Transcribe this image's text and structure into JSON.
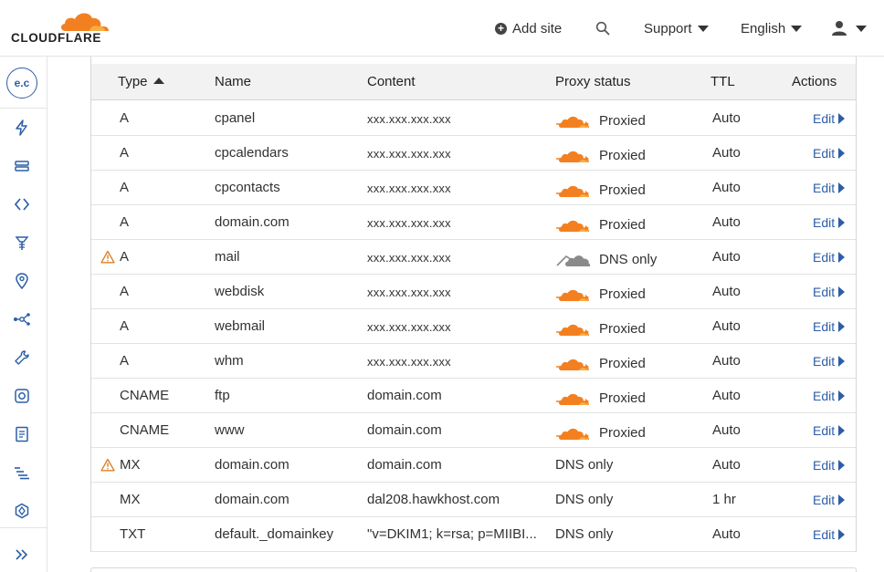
{
  "header": {
    "logo_text": "CLOUDFLARE",
    "add_site_label": "Add site",
    "support_label": "Support",
    "language_label": "English"
  },
  "sidebar": {
    "account_badge": "e.c",
    "items": [
      {
        "icon": "bolt-icon"
      },
      {
        "icon": "server-icon"
      },
      {
        "icon": "diamond-arrows-icon"
      },
      {
        "icon": "antenna-icon"
      },
      {
        "icon": "location-pin-icon"
      },
      {
        "icon": "network-icon"
      },
      {
        "icon": "wrench-icon"
      },
      {
        "icon": "app-icon"
      },
      {
        "icon": "document-icon"
      },
      {
        "icon": "list-icon"
      },
      {
        "icon": "hexagon-icon"
      }
    ],
    "expand_icon": "double-chevron-right-icon"
  },
  "table": {
    "columns": {
      "type": "Type",
      "name": "Name",
      "content": "Content",
      "proxy": "Proxy status",
      "ttl": "TTL",
      "actions": "Actions"
    },
    "edit_label": "Edit",
    "rows": [
      {
        "type": "A",
        "name": "cpanel",
        "content": "xxx.xxx.xxx.xxx",
        "proxy": "Proxied",
        "cloud": "orange",
        "ttl": "Auto",
        "warning": false
      },
      {
        "type": "A",
        "name": "cpcalendars",
        "content": "xxx.xxx.xxx.xxx",
        "proxy": "Proxied",
        "cloud": "orange",
        "ttl": "Auto",
        "warning": false
      },
      {
        "type": "A",
        "name": "cpcontacts",
        "content": "xxx.xxx.xxx.xxx",
        "proxy": "Proxied",
        "cloud": "orange",
        "ttl": "Auto",
        "warning": false
      },
      {
        "type": "A",
        "name": "domain.com",
        "content": "xxx.xxx.xxx.xxx",
        "proxy": "Proxied",
        "cloud": "orange",
        "ttl": "Auto",
        "warning": false
      },
      {
        "type": "A",
        "name": "mail",
        "content": "xxx.xxx.xxx.xxx",
        "proxy": "DNS only",
        "cloud": "grey",
        "ttl": "Auto",
        "warning": true
      },
      {
        "type": "A",
        "name": "webdisk",
        "content": "xxx.xxx.xxx.xxx",
        "proxy": "Proxied",
        "cloud": "orange",
        "ttl": "Auto",
        "warning": false
      },
      {
        "type": "A",
        "name": "webmail",
        "content": "xxx.xxx.xxx.xxx",
        "proxy": "Proxied",
        "cloud": "orange",
        "ttl": "Auto",
        "warning": false
      },
      {
        "type": "A",
        "name": "whm",
        "content": "xxx.xxx.xxx.xxx",
        "proxy": "Proxied",
        "cloud": "orange",
        "ttl": "Auto",
        "warning": false
      },
      {
        "type": "CNAME",
        "name": "ftp",
        "content": "domain.com",
        "proxy": "Proxied",
        "cloud": "orange",
        "ttl": "Auto",
        "warning": false
      },
      {
        "type": "CNAME",
        "name": "www",
        "content": "domain.com",
        "proxy": "Proxied",
        "cloud": "orange",
        "ttl": "Auto",
        "warning": false
      },
      {
        "type": "MX",
        "name": "domain.com",
        "content": "domain.com",
        "proxy": "DNS only",
        "cloud": "none",
        "ttl": "Auto",
        "warning": true
      },
      {
        "type": "MX",
        "name": "domain.com",
        "content": "dal208.hawkhost.com",
        "proxy": "DNS only",
        "cloud": "none",
        "ttl": "1 hr",
        "warning": false
      },
      {
        "type": "TXT",
        "name": "default._domainkey",
        "content": "\"v=DKIM1; k=rsa; p=MIIBI...",
        "proxy": "DNS only",
        "cloud": "none",
        "ttl": "Auto",
        "warning": false
      }
    ]
  },
  "colors": {
    "brand_orange": "#f38020",
    "link_blue": "#2c5ea8",
    "warning_orange": "#d9822b",
    "dns_grey": "#8a8a8a"
  }
}
